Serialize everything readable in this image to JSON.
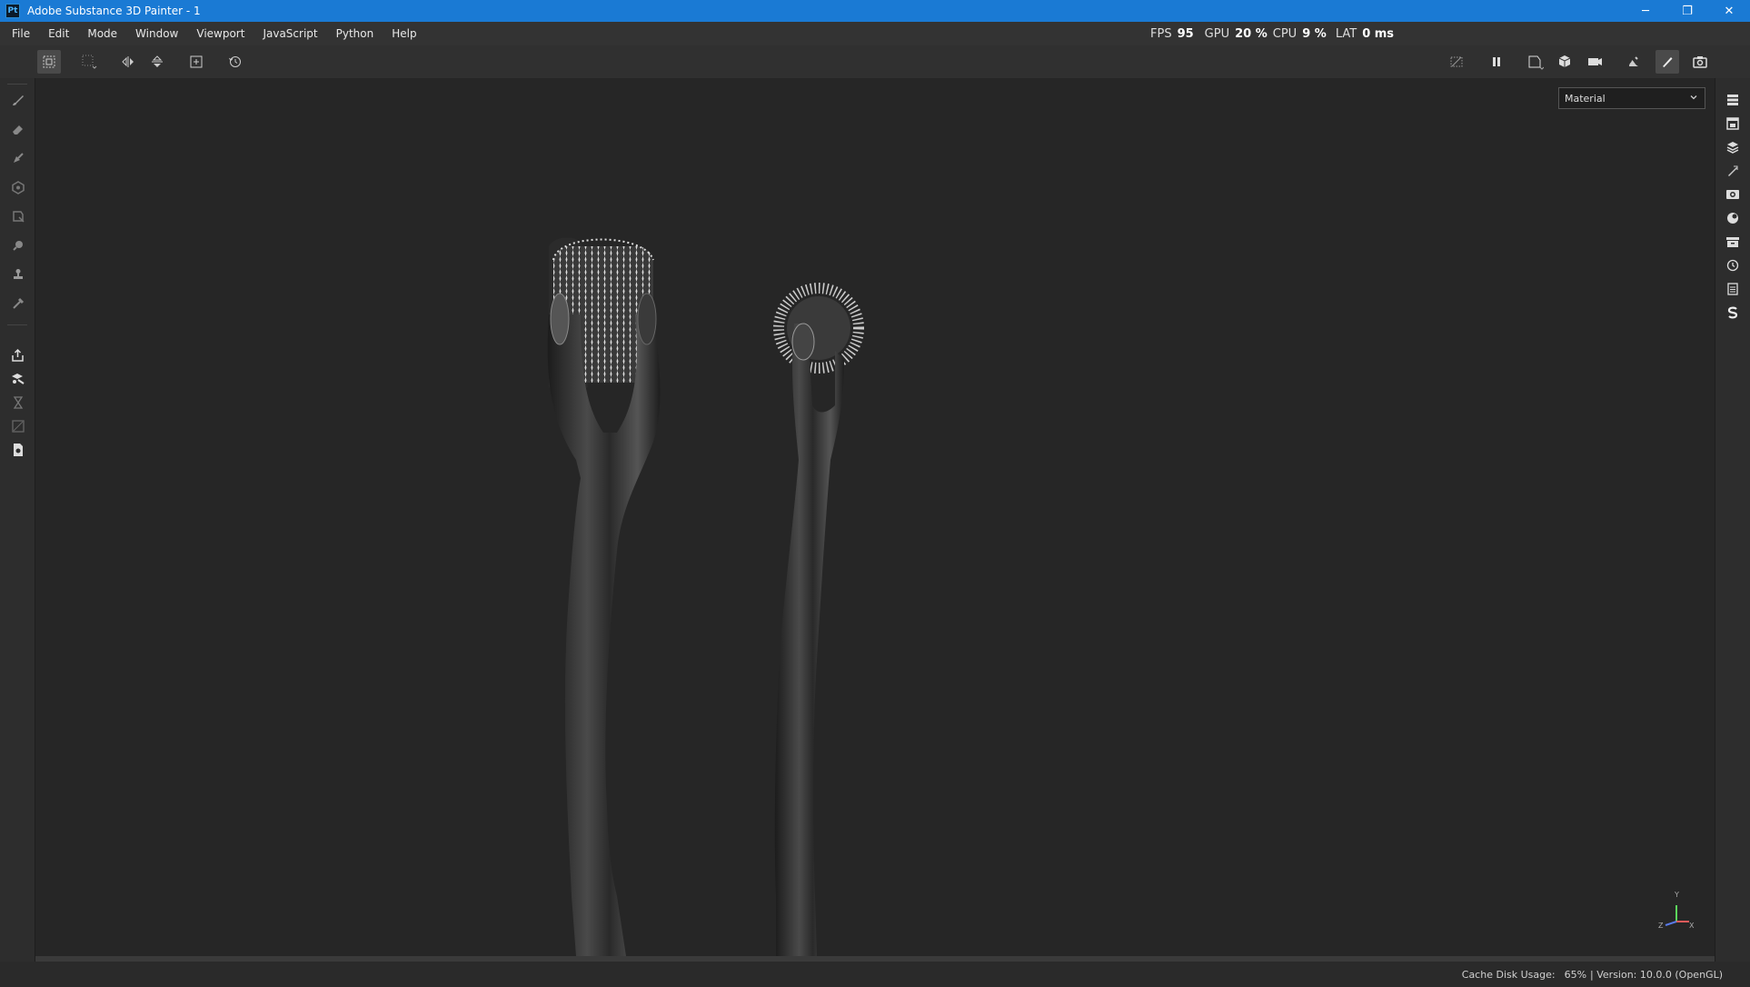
{
  "window": {
    "title": "Adobe Substance 3D Painter - 1",
    "app_icon": "Pt",
    "controls": {
      "minimize": "─",
      "restore": "❐",
      "close": "✕"
    }
  },
  "menu": [
    "File",
    "Edit",
    "Mode",
    "Window",
    "Viewport",
    "JavaScript",
    "Python",
    "Help"
  ],
  "stats": {
    "fps_label": "FPS",
    "fps_value": "95",
    "gpu_label": "GPU",
    "gpu_value": "20 %",
    "cpu_label": "CPU",
    "cpu_value": "9 %",
    "lat_label": "LAT",
    "lat_value": "0 ms"
  },
  "viewport": {
    "mode_select": "Material",
    "axis": {
      "y": "Y",
      "x": "X",
      "z": "Z"
    }
  },
  "status": {
    "cache_label": "Cache Disk Usage:",
    "cache_value": "65%",
    "version": "| Version: 10.0.0 (OpenGL)"
  },
  "colors": {
    "titlebar": "#1a7ad4",
    "background": "#262626"
  }
}
